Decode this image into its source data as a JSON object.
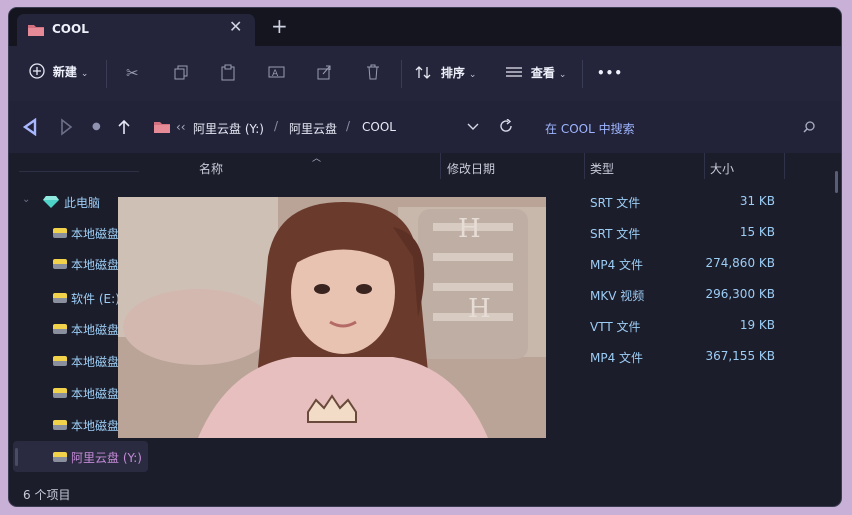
{
  "tab": {
    "title": "COOL",
    "close": "✕",
    "new": "+"
  },
  "toolbar": {
    "new_label": "新建",
    "sort_label": "排序",
    "view_label": "查看",
    "more": "•••"
  },
  "address": {
    "crumb_prefix": "‹‹",
    "crumbs": [
      "阿里云盘 (Y:)",
      "阿里云盘",
      "COOL"
    ],
    "separator": "/",
    "search_placeholder": "在 COOL 中搜索"
  },
  "columns": {
    "name": "名称",
    "date": "修改日期",
    "type": "类型",
    "size": "大小"
  },
  "sidebar": {
    "items": [
      {
        "label": "此电脑"
      },
      {
        "label": "本地磁盘"
      },
      {
        "label": "本地磁盘"
      },
      {
        "label": "软件 (E:)"
      },
      {
        "label": "本地磁盘"
      },
      {
        "label": "本地磁盘"
      },
      {
        "label": "本地磁盘"
      },
      {
        "label": "本地磁盘"
      },
      {
        "label": "阿里云盘 (Y:)"
      }
    ]
  },
  "files": [
    {
      "type": "SRT 文件",
      "size": "31 KB"
    },
    {
      "type": "SRT 文件",
      "size": "15 KB"
    },
    {
      "type": "MP4 文件",
      "size": "274,860 KB"
    },
    {
      "type": "MKV 视频",
      "size": "296,300 KB"
    },
    {
      "type": "VTT 文件",
      "size": "19 KB"
    },
    {
      "type": "MP4 文件",
      "size": "367,155 KB"
    }
  ],
  "status": {
    "count": "6 个项目"
  },
  "colors": {
    "accent": "#9fb5ff",
    "selected": "#c58bd6",
    "window_bg": "#1c1d2b"
  }
}
